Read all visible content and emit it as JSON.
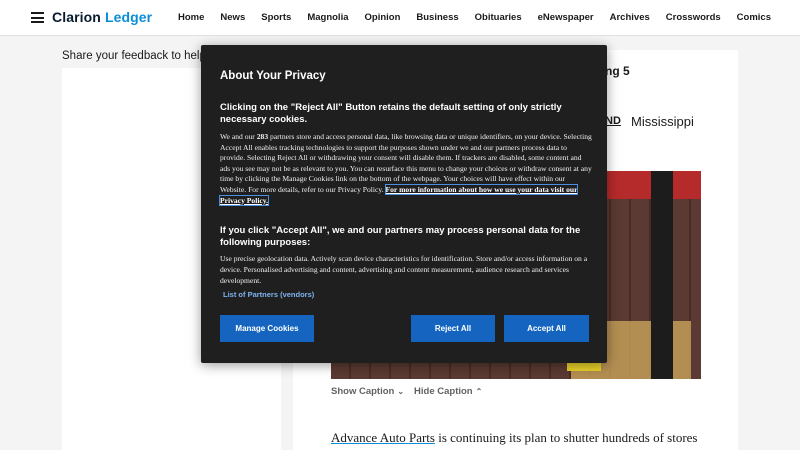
{
  "header": {
    "logo_part1": "Clarion",
    "logo_part2": "Ledger",
    "nav": [
      "Home",
      "News",
      "Sports",
      "Magnolia",
      "Opinion",
      "Business",
      "Obituaries",
      "eNewspaper",
      "Archives",
      "Crosswords",
      "Comics"
    ]
  },
  "page": {
    "feedback_text": "Share your feedback to help i",
    "headline_tail": "ng 5",
    "byline_link": "ND",
    "byline_tail": "Mississippi",
    "show_caption": "Show Caption",
    "hide_caption": "Hide Caption",
    "lead_link": "Advance Auto Parts",
    "lead_text": " is continuing its plan to shutter hundreds of stores"
  },
  "modal": {
    "title": "About Your Privacy",
    "heading1": "Clicking on the \"Reject All\" Button retains the default setting of only strictly necessary cookies.",
    "p1_before_count": "We and our ",
    "partner_count": "283",
    "p1_after_count": " partners store and access personal data, like browsing data or unique identifiers, on your device. Selecting Accept All enables tracking technologies to support the purposes shown under we and our partners process data to provide. Selecting Reject All or withdrawing your consent will disable them. If trackers are disabled, some content and ads you see may not be as relevant to you. You can resurface this menu to change your choices or withdraw consent at any time by clicking the Manage Cookies link on the bottom of the webpage. Your choices will have effect within our Website. For more details, refer to our Privacy Policy. ",
    "p1_link": "For more information about how we use your data visit our Privacy Policy.",
    "heading2": "If you click \"Accept All\", we and our partners may process personal data for the following purposes:",
    "p2": "Use precise geolocation data. Actively scan device characteristics for identification. Store and/or access information on a device. Personalised advertising and content, advertising and content measurement, audience research and services development.",
    "partners_link": "List of Partners (vendors)",
    "manage_label": "Manage Cookies",
    "reject_label": "Reject All",
    "accept_label": "Accept All"
  },
  "colors": {
    "brand_blue": "#0a8dd6",
    "button_blue": "#1565c0",
    "modal_bg": "#1f1f1f"
  }
}
